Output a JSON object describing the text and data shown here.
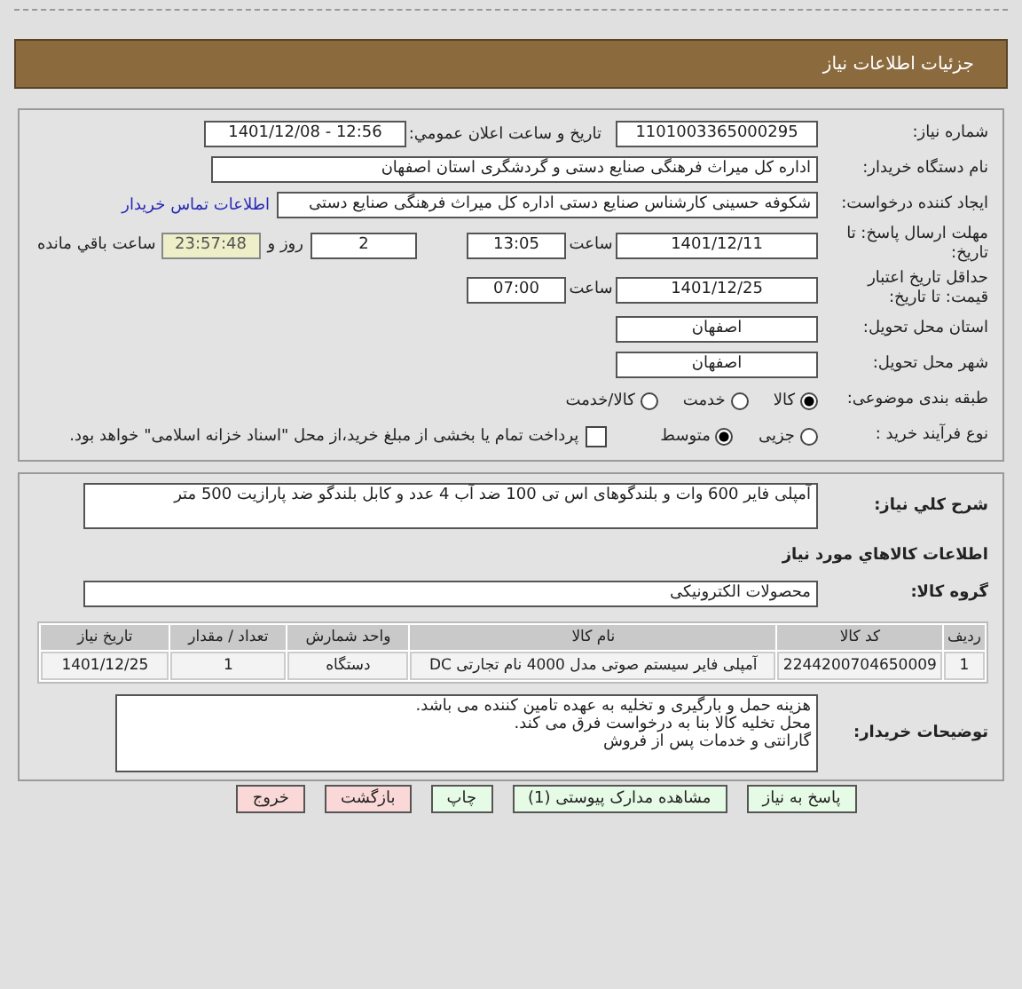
{
  "header": {
    "title": "جزئیات اطلاعات نیاز"
  },
  "request": {
    "need_number": {
      "label": "شماره نیاز:",
      "value": "1101003365000295"
    },
    "announce": {
      "label": "تاریخ و ساعت اعلان عمومي:",
      "value": "1401/12/08 - 12:56"
    },
    "buyer": {
      "label": "نام دستگاه خریدار:",
      "value": "اداره کل میراث فرهنگی  صنایع دستی و گردشگری استان اصفهان"
    },
    "creator": {
      "label": "ایجاد کننده درخواست:",
      "value": "شکوفه حسینی کارشناس صنایع دستی اداره کل میراث فرهنگی  صنایع دستی",
      "link": "اطلاعات تماس خریدار"
    },
    "deadline": {
      "label": "مهلت ارسال پاسخ: تا تاریخ:",
      "date": "1401/12/11",
      "time_label": "ساعت",
      "time": "13:05",
      "days": "2",
      "days_label": "روز و",
      "remaining": "23:57:48",
      "remaining_label": "ساعت باقي مانده"
    },
    "validity": {
      "label": "حداقل تاریخ اعتبار قیمت: تا تاریخ:",
      "date": "1401/12/25",
      "time_label": "ساعت",
      "time": "07:00"
    },
    "province": {
      "label": "استان محل تحویل:",
      "value": "اصفهان"
    },
    "city": {
      "label": "شهر محل تحویل:",
      "value": "اصفهان"
    },
    "category": {
      "label": "طبقه بندی موضوعی:",
      "options": [
        {
          "label": "کالا",
          "selected": true
        },
        {
          "label": "خدمت",
          "selected": false
        },
        {
          "label": "کالا/خدمت",
          "selected": false
        }
      ]
    },
    "process": {
      "label": "نوع فرآیند خرید :",
      "options": [
        {
          "label": "جزیی",
          "selected": false
        },
        {
          "label": "متوسط",
          "selected": true
        }
      ],
      "treasury": {
        "checked": false,
        "text": "پرداخت تمام یا بخشی از مبلغ خرید،از محل \"اسناد خزانه اسلامی\" خواهد بود."
      }
    }
  },
  "details": {
    "description": {
      "label": "شرح کلي نیاز:",
      "value": "آمپلی فایر 600 وات و بلندگوهای اس تی 100 ضد آب 4 عدد و کابل بلندگو ضد پارازیت 500 متر"
    },
    "goods_heading": "اطلاعات کالاهاي مورد نیاز",
    "group": {
      "label": "گروه کالا:",
      "value": "محصولات الکترونیکی"
    },
    "table": {
      "columns": [
        "ردیف",
        "کد کالا",
        "نام کالا",
        "واحد شمارش",
        "تعداد / مقدار",
        "تاریخ نیاز"
      ],
      "rows": [
        [
          "1",
          "2244200704650009",
          "آمپلی فایر سیستم صوتی مدل 4000 نام تجارتی DC",
          "دستگاه",
          "1",
          "1401/12/25"
        ]
      ]
    },
    "notes": {
      "label": "توضیحات خریدار:",
      "lines": [
        "هزینه حمل و بارگیری و تخلیه به عهده تامین کننده می باشد.",
        "محل تخلیه کالا بنا به درخواست فرق می کند.",
        "گارانتی و خدمات پس از فروش"
      ]
    }
  },
  "buttons": [
    {
      "label": "پاسخ به نیاز",
      "kind": "action"
    },
    {
      "label": "مشاهده مدارک پیوستی (1)",
      "kind": "action"
    },
    {
      "label": "چاپ",
      "kind": "action"
    },
    {
      "label": "بازگشت",
      "kind": "exit"
    },
    {
      "label": "خروج",
      "kind": "exit"
    }
  ]
}
